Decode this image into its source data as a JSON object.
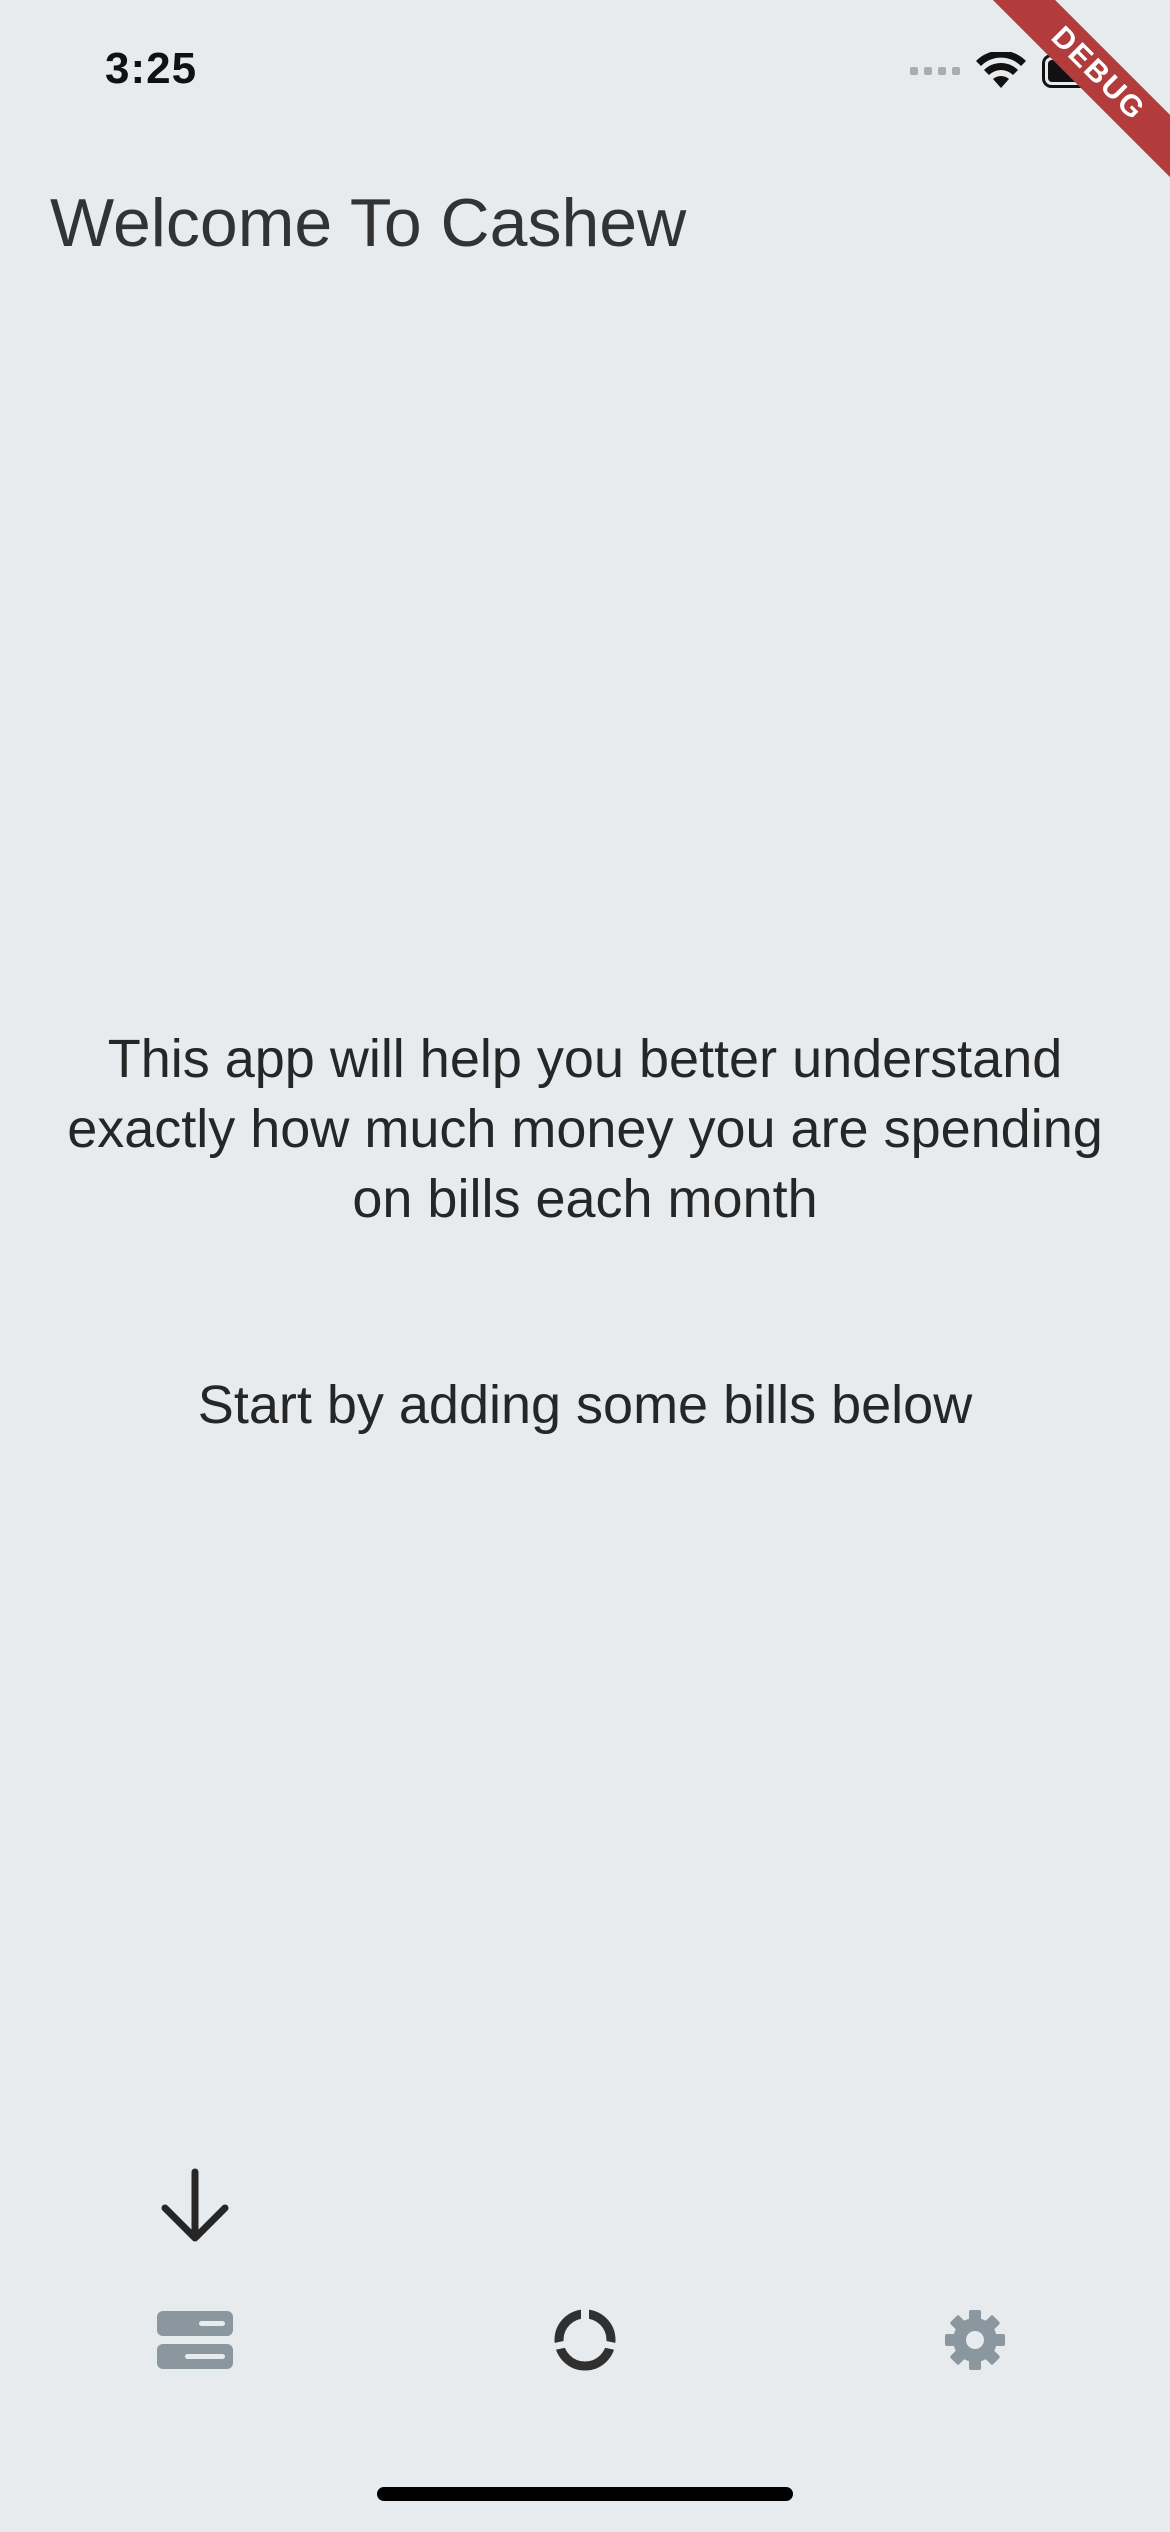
{
  "status_bar": {
    "time": "3:25"
  },
  "debug_banner": {
    "label": "DEBUG"
  },
  "header": {
    "title": "Welcome To Cashew"
  },
  "main": {
    "intro": "This app will help you better understand exactly how much money you are spending on bills each month",
    "cta": "Start by adding some bills below"
  },
  "bottom_nav": {
    "items": [
      {
        "icon": "bills-icon"
      },
      {
        "icon": "donut-chart-icon"
      },
      {
        "icon": "gear-icon"
      }
    ]
  },
  "colors": {
    "background": "#e8ebed",
    "nav_inactive": "#8a979f",
    "nav_active": "#303030",
    "debug_banner": "#b23b3b"
  }
}
